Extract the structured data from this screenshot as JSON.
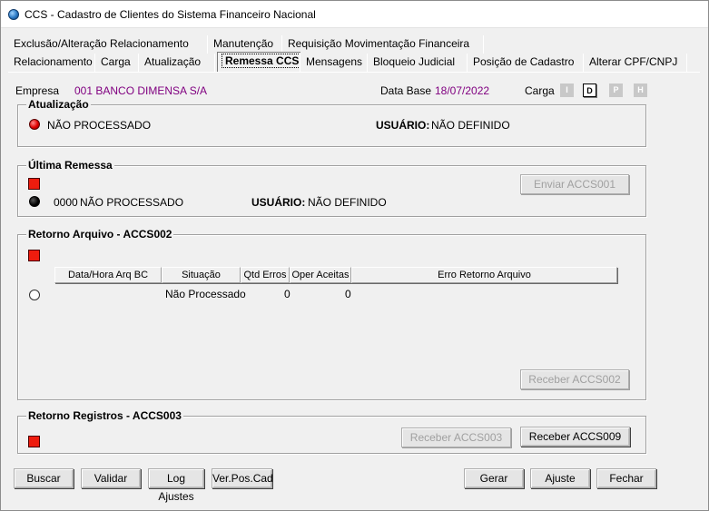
{
  "window": {
    "title": "CCS - Cadastro de Clientes do Sistema Financeiro Nacional"
  },
  "tabs": {
    "row1": [
      "Exclusão/Alteração Relacionamento",
      "Manutenção",
      "Requisição Movimentação Financeira"
    ],
    "row2": [
      "Relacionamento",
      "Carga",
      "Atualização",
      "Remessa CCS",
      "Mensagens",
      "Bloqueio Judicial",
      "Posição de Cadastro",
      "Alterar CPF/CNPJ"
    ],
    "active": "Remessa CCS"
  },
  "header": {
    "empresa_label": "Empresa",
    "empresa_value": "001  BANCO DIMENSA S/A",
    "database_label": "Data Base",
    "database_value": "18/07/2022",
    "carga_label": "Carga",
    "carga_options": [
      "I",
      "D",
      "P",
      "H"
    ],
    "carga_selected": "D"
  },
  "atualizacao": {
    "title": "Atualização",
    "status": "NÃO PROCESSADO",
    "usuario_label": "USUÁRIO:",
    "usuario_value": "NÃO DEFINIDO"
  },
  "ultima_remessa": {
    "title": "Última Remessa",
    "numero": "0000",
    "status": "NÃO PROCESSADO",
    "usuario_label": "USUÁRIO:",
    "usuario_value": "NÃO DEFINIDO",
    "button": "Enviar ACCS001"
  },
  "retorno_arquivo": {
    "title": "Retorno Arquivo - ACCS002",
    "columns": [
      "Data/Hora Arq BC",
      "Situação",
      "Qtd Erros",
      "Oper Aceitas",
      "Erro Retorno Arquivo"
    ],
    "row": {
      "data_hora": "",
      "situacao": "Não Processado",
      "qtd_erros": "0",
      "oper_aceitas": "0",
      "erro": ""
    },
    "button": "Receber ACCS002"
  },
  "retorno_registros": {
    "title": "Retorno Registros - ACCS003",
    "button_accs003": "Receber ACCS003",
    "button_accs009": "Receber ACCS009"
  },
  "footer": {
    "buscar": "Buscar",
    "validar": "Validar",
    "log_ajustes": "Log Ajustes",
    "ver_pos_cad": "Ver.Pos.Cad",
    "gerar": "Gerar",
    "ajuste": "Ajuste",
    "fechar": "Fechar"
  },
  "colors": {
    "accent_purple": "#800080",
    "status_red": "#ee1c0e",
    "disabled_text": "#a0a0a0"
  }
}
